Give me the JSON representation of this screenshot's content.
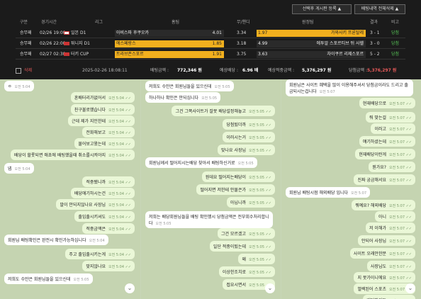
{
  "toolbar": {
    "delete_selected": "선택후 게시판 등록 ▲",
    "delete_all": "배팅내역 전체삭제 ▲"
  },
  "table": {
    "headers": [
      "구분",
      "경기시간",
      "리그",
      "홈팀",
      "무/핸디",
      "원정팀",
      "결과",
      "비고"
    ],
    "rows": [
      {
        "type": "승무패",
        "time": "02/26 19:00",
        "league": "일본 D1",
        "home": "아비스파 후쿠오카",
        "home_odds": "4.01",
        "draw": "3.34",
        "away_odds": "1.97",
        "away": "가와사키 프론탈레",
        "score": "3 - 1",
        "status": "당첨"
      },
      {
        "type": "승무패",
        "time": "02/26 22:00",
        "league": "튀니지 D1",
        "home": "에스페랑스",
        "home_odds": "1.85",
        "draw": "3.18",
        "away_odds": "4.99",
        "away": "에투알 스포르티브 뒤 사헬",
        "score": "3 - 0",
        "status": "당첨"
      },
      {
        "type": "승무패",
        "time": "02/27 02:30",
        "league": "터키 CUP",
        "home": "트라브존스포르",
        "home_odds": "1.91",
        "draw": "3.75",
        "away_odds": "3.63",
        "away": "차이쿠르 리제스포르",
        "score": "5 - 2",
        "status": "당첨"
      }
    ],
    "footer": {
      "delete": "삭제",
      "datetime": "2025-02-26 18:08:11",
      "bet_label": "배팅금액 :",
      "bet_amount": "772,346 원",
      "odds_label": "예상배당 :",
      "odds": "6.96 배",
      "expected_label": "예상적중금액 :",
      "expected": "5,376,297 원",
      "win_label": "당첨금액 :",
      "win": "5,376,297 원"
    }
  },
  "chat1": [
    {
      "text": "ㅇ",
      "time": "오전 5:04",
      "side": "in"
    },
    {
      "text": "혼배터리가없어서",
      "time": "오전 5:04",
      "side": "out"
    },
    {
      "text": "친구불로했습니다",
      "time": "오전 5:04",
      "side": "out"
    },
    {
      "text": "근데 제가 지인한테",
      "time": "오전 5:04",
      "side": "out"
    },
    {
      "text": "전화해보고",
      "time": "오전 5:04",
      "side": "out"
    },
    {
      "text": "물어보고왔는데",
      "time": "오전 5:04",
      "side": "out"
    },
    {
      "text": "배당이 할롯되면 애초에 배팅했을때 취소를시켜야지",
      "time": "오전 5:04",
      "side": "out"
    },
    {
      "text": "넵",
      "time": "오전 5:04",
      "side": "in"
    },
    {
      "text": "적중됐니까",
      "time": "오전 5:04",
      "side": "out"
    },
    {
      "text": "배당애기하시는건",
      "time": "오전 5:04",
      "side": "out"
    },
    {
      "text": "말이 안되지않나요 사장님",
      "time": "오전 5:04",
      "side": "out"
    },
    {
      "text": "출입출시키셔도",
      "time": "오전 5:04",
      "side": "out"
    },
    {
      "text": "적중금액은",
      "time": "오전 5:04",
      "side": "out"
    },
    {
      "text": "회원님 배팅확인은 완전시 확인가능하십니다",
      "time": "오전 5:04",
      "side": "in"
    },
    {
      "text": "주고 출입출시키는게",
      "time": "오전 5:04",
      "side": "out"
    },
    {
      "text": "맞지않나요",
      "time": "오전 5:04",
      "side": "out"
    },
    {
      "text": "저희도 수만은 회원님들을 있으신데",
      "time": "오전 5:05",
      "side": "in"
    }
  ],
  "chat2": [
    {
      "text": "저희도 수만은 회원님들을 있으신데",
      "time": "오전 5:05",
      "side": "in"
    },
    {
      "text": "하나하나 확인은 안되십니다",
      "time": "오전 5:05",
      "side": "in"
    },
    {
      "text": "그건 그쪽사이트가 잘못 배당설정해놓고",
      "time": "오전 5:05",
      "side": "out"
    },
    {
      "text": "당첨됬더까",
      "time": "오전 5:05",
      "side": "out"
    },
    {
      "text": "이러시는거",
      "time": "오전 5:05",
      "side": "out"
    },
    {
      "text": "맞나요 사장님",
      "time": "오전 5:05",
      "side": "out"
    },
    {
      "text": "회원님께서 떨어지시는배당 찾아서 배팅하신거로",
      "time": "오전 5:05",
      "side": "in"
    },
    {
      "text": "뭔데요 떨어지는배당이",
      "time": "오전 5:05",
      "side": "out"
    },
    {
      "text": "떨어지면 저한테 안물은가",
      "time": "오전 5:05",
      "side": "out"
    },
    {
      "text": "아닙니까",
      "time": "오전 5:05",
      "side": "out"
    },
    {
      "text": "저희는 배당회원님들을 배팅 확인했시 당첨금액은 전부회수처리합니다",
      "time": "오전 5:05",
      "side": "in"
    },
    {
      "text": "그건 모르겠고",
      "time": "오전 5:05",
      "side": "out"
    },
    {
      "text": "일단 적중이됬는데",
      "time": "오전 5:05",
      "side": "out"
    },
    {
      "text": "왜",
      "time": "오전 5:05",
      "side": "out"
    },
    {
      "text": "이상한조치로",
      "time": "오전 5:05",
      "side": "out"
    },
    {
      "text": "접요시면서",
      "time": "오전 5:05",
      "side": "out"
    }
  ],
  "chat3": [
    {
      "text": "회원님은 사이트 혜택을 많이 이용해주셔서 당첨금이라도 드리고 출금되시는겁니다",
      "time": "오전 5:07",
      "side": "in"
    },
    {
      "text": "현재배당으로",
      "time": "오전 5:07",
      "side": "out"
    },
    {
      "text": "줘 맞는걸",
      "time": "오전 5:07",
      "side": "out"
    },
    {
      "text": "이러고",
      "time": "오전 5:07",
      "side": "out"
    },
    {
      "text": "얘기하셨는데",
      "time": "오전 5:07",
      "side": "out"
    },
    {
      "text": "현재배당이란게",
      "time": "오전 5:07",
      "side": "out"
    },
    {
      "text": "뭔가요?",
      "time": "오전 5:07",
      "side": "out"
    },
    {
      "text": "진짜 궁금해서요",
      "time": "오전 5:07",
      "side": "out"
    },
    {
      "text": "회원님 배팅시점 해외배당 입니다",
      "time": "오전 5:07",
      "side": "in"
    },
    {
      "text": "뭐예요? 해외배당",
      "time": "오전 5:07",
      "side": "out"
    },
    {
      "text": "아니",
      "time": "오전 5:07",
      "side": "out"
    },
    {
      "text": "저 이해가",
      "time": "오전 5:07",
      "side": "out"
    },
    {
      "text": "안되어 사장님",
      "time": "오전 5:07",
      "side": "out"
    },
    {
      "text": "사이트 오래안한분",
      "time": "오전 5:07",
      "side": "out"
    },
    {
      "text": "사장님도",
      "time": "오전 5:07",
      "side": "out"
    },
    {
      "text": "지 못가이니에요",
      "time": "오전 5:07",
      "side": "out"
    },
    {
      "text": "벌렉된어 스포츠",
      "time": "오전 5:07",
      "side": "out"
    },
    {
      "text": "배팅하거든",
      "time": "오전 5:07",
      "side": "out"
    }
  ]
}
